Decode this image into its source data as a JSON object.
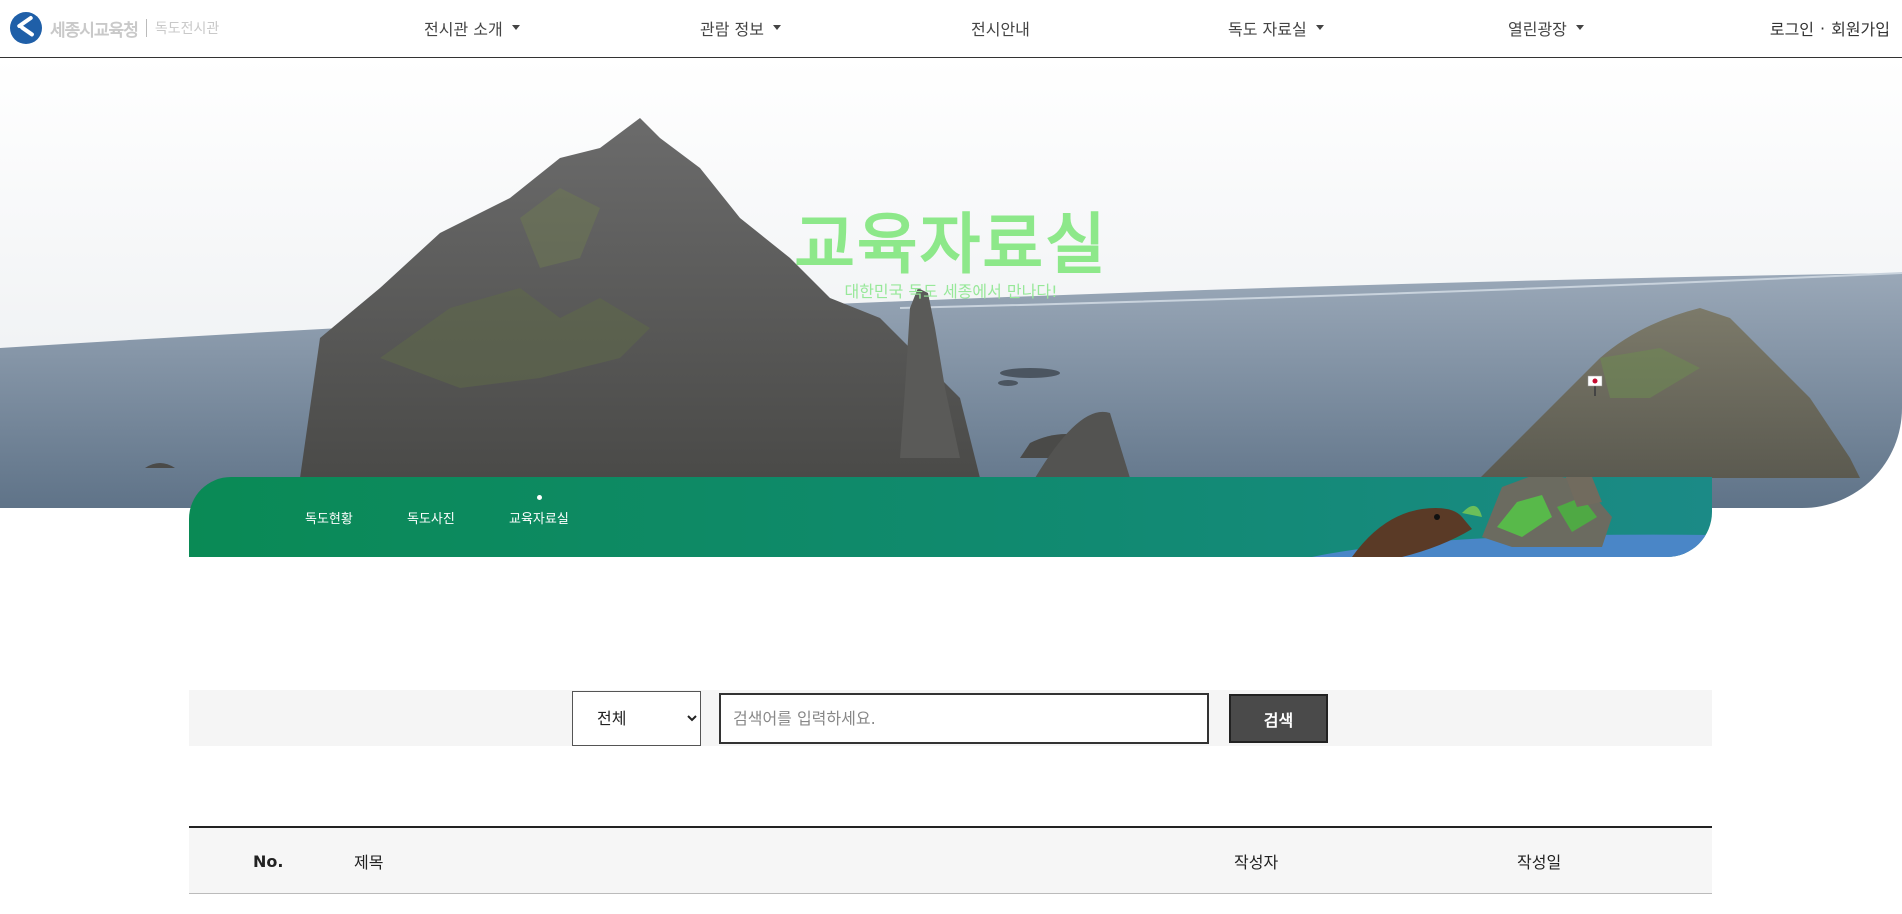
{
  "header": {
    "logo_text": "세종시교육청",
    "logo_sub": "독도전시관",
    "nav": [
      {
        "label": "전시관 소개",
        "has_dropdown": true
      },
      {
        "label": "관람 정보",
        "has_dropdown": true
      },
      {
        "label": "전시안내",
        "has_dropdown": false
      },
      {
        "label": "독도 자료실",
        "has_dropdown": true
      },
      {
        "label": "열린광장",
        "has_dropdown": true
      }
    ],
    "login": "로그인",
    "separator": "·",
    "join": "회원가입"
  },
  "hero": {
    "title": "교육자료실",
    "subtitle": "대한민국 독도 세종에서 만나다!"
  },
  "subnav": {
    "items": [
      {
        "label": "독도현황",
        "active": false
      },
      {
        "label": "독도사진",
        "active": false
      },
      {
        "label": "교육자료실",
        "active": true
      }
    ]
  },
  "search": {
    "select_value": "전체",
    "placeholder": "검색어를 입력하세요.",
    "button": "검색"
  },
  "table": {
    "headers": [
      "No.",
      "제목",
      "작성자",
      "작성일"
    ]
  },
  "colors": {
    "accent_green": "#0a8a55",
    "hero_title": "#8de88a",
    "button_dark": "#4a4a4a"
  }
}
